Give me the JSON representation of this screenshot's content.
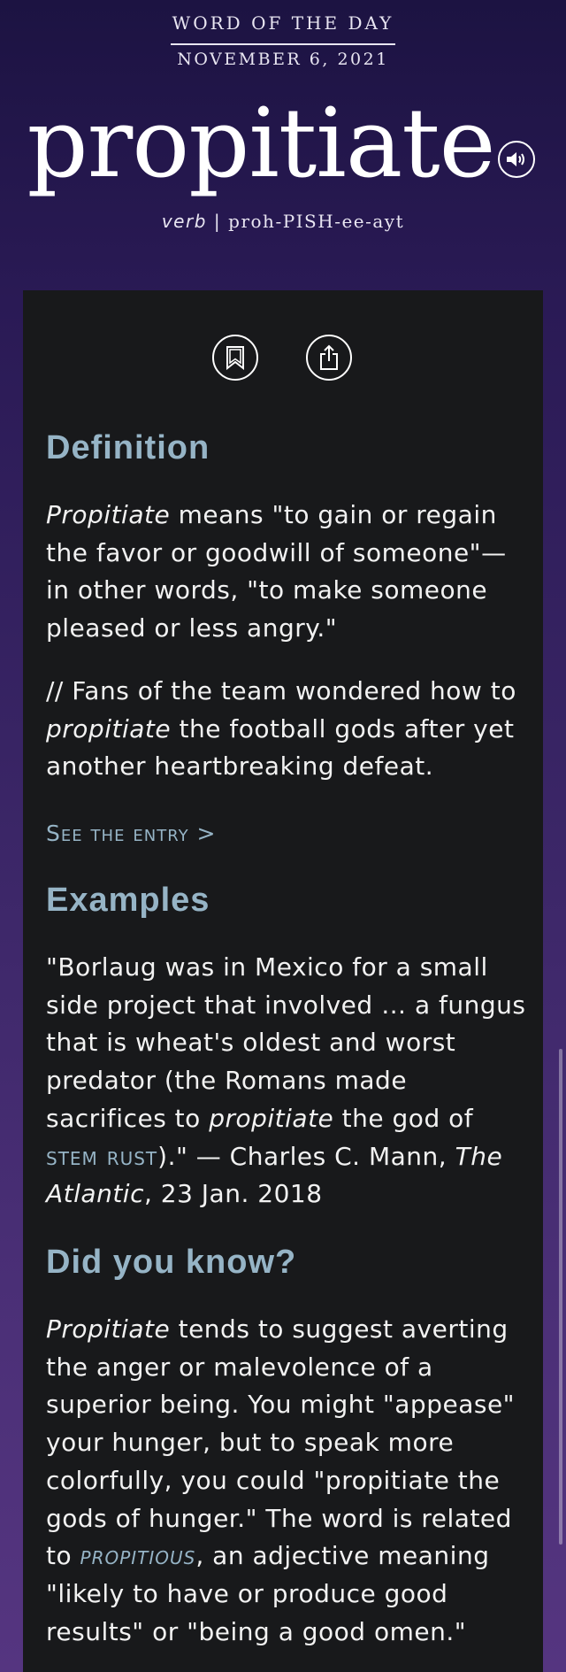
{
  "header": {
    "label": "WORD OF THE DAY",
    "date": "NOVEMBER 6, 2021",
    "word": "propitiate",
    "part_of_speech": "verb",
    "separator": "|",
    "pronunciation": "proh-PISH-ee-ayt"
  },
  "icons": {
    "audio": "speaker-icon",
    "bookmark": "bookmark-icon",
    "share": "share-icon"
  },
  "definition": {
    "heading": "Definition",
    "term": "Propitiate",
    "text_1": " means \"to gain or regain the favor or goodwill of someone\"—in other words, \"to make someone pleased or less angry.\"",
    "example_pre": "// Fans of the team wondered how to ",
    "example_term": "propitiate",
    "example_post": " the football gods after yet another heartbreaking defeat.",
    "link": "See the entry >"
  },
  "examples": {
    "heading": "Examples",
    "quote_pre": "\"Borlaug was in Mexico for a small side project that involved … a fungus that is wheat's oldest and worst predator (the Romans made sacrifices to ",
    "quote_term": "propitiate",
    "quote_mid": " the god of ",
    "quote_smallcaps": "stem rust",
    "quote_post": ").\" — Charles C. Mann, ",
    "source": "The Atlantic",
    "source_date": ", 23 Jan. 2018"
  },
  "did_you_know": {
    "heading": "Did you know?",
    "term": "Propitiate",
    "text_1": " tends to suggest averting the anger or malevolence of a superior being. You might \"appease\" your hunger, but to speak more colorfully, you could \"propitiate the gods of hunger.\" The word is related to ",
    "link": "propitious",
    "text_2": ", an adjective meaning \"likely to have or produce good results\" or \"being a good omen.\""
  },
  "colors": {
    "background_top": "#1c1342",
    "background_bottom": "#553580",
    "card": "#18191b",
    "heading": "#96b4c6",
    "link": "#96b4c6",
    "text": "#f2f2f2"
  }
}
